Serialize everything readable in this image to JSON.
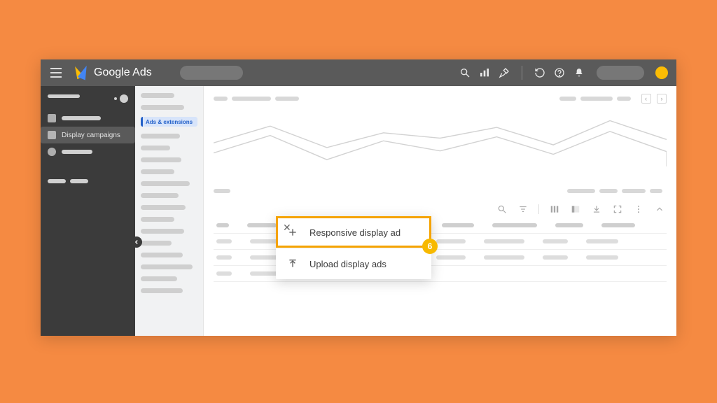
{
  "topbar": {
    "app_title": "Google Ads"
  },
  "sidebar_dark": {
    "selected_label": "Display campaigns"
  },
  "nav_light": {
    "selected_label": "Ads & extensions"
  },
  "popup": {
    "responsive_label": "Responsive display ad",
    "upload_label": "Upload display ads",
    "step_number": "6"
  },
  "chart_data": {
    "type": "line",
    "series": [
      {
        "name": "series_a",
        "points": [
          [
            0,
            55
          ],
          [
            80,
            80
          ],
          [
            160,
            48
          ],
          [
            240,
            70
          ],
          [
            320,
            62
          ],
          [
            400,
            78
          ],
          [
            480,
            52
          ],
          [
            560,
            88
          ],
          [
            640,
            60
          ]
        ]
      },
      {
        "name": "series_b",
        "points": [
          [
            0,
            40
          ],
          [
            80,
            66
          ],
          [
            160,
            30
          ],
          [
            240,
            58
          ],
          [
            320,
            43
          ],
          [
            400,
            64
          ],
          [
            480,
            38
          ],
          [
            560,
            72
          ],
          [
            640,
            42
          ],
          [
            640,
            20
          ]
        ]
      }
    ],
    "ylim": [
      0,
      100
    ]
  }
}
